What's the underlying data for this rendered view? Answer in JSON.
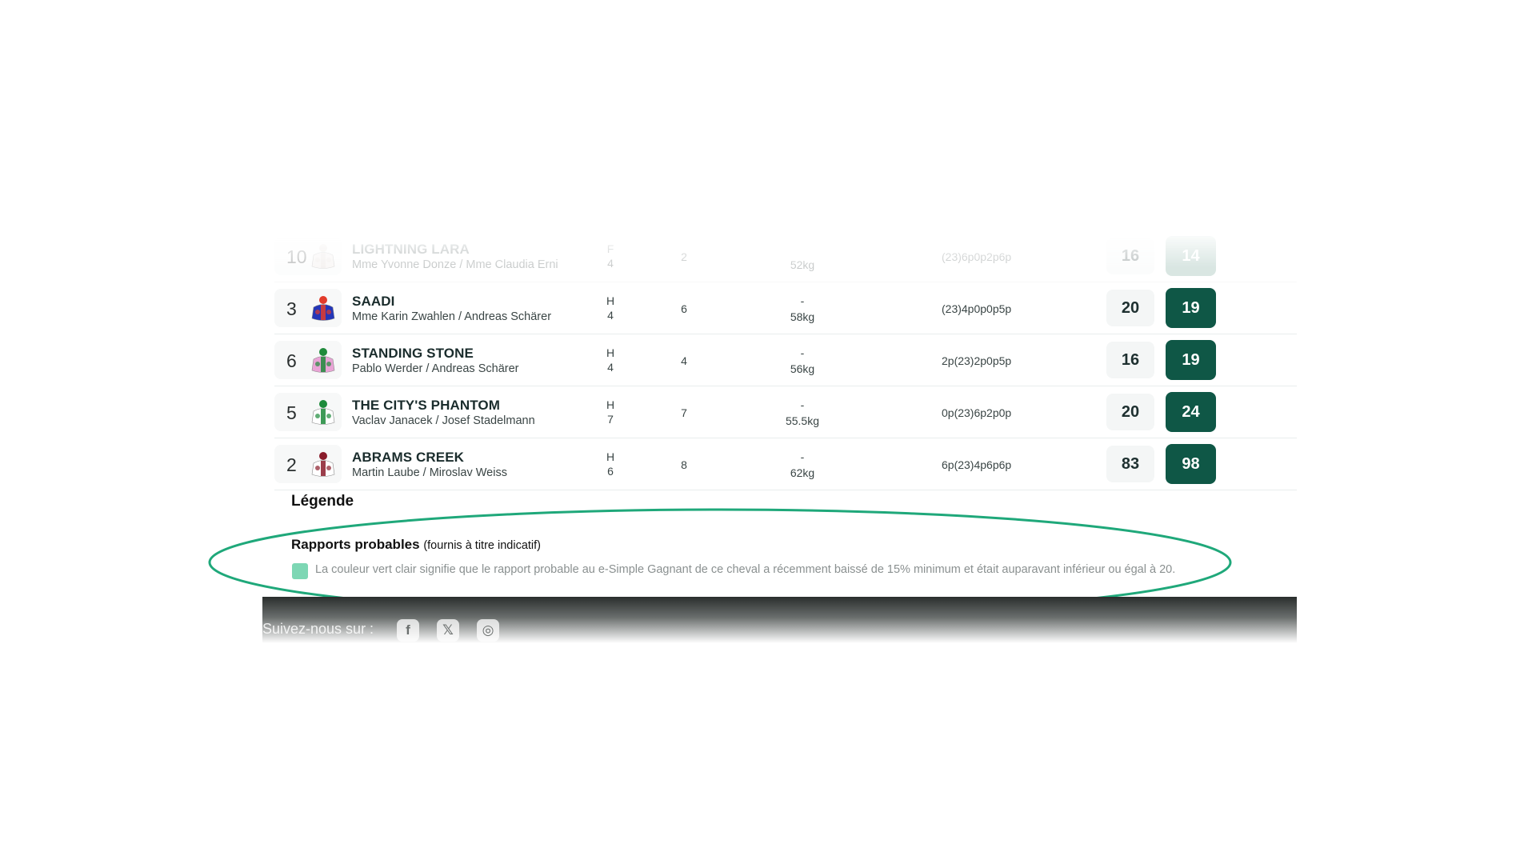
{
  "runners": [
    {
      "num": "10",
      "name": "LIGHTNING LARA",
      "people": "Mme Yvonne Donze / Mme Claudia Erni",
      "sex": "F",
      "age": "4",
      "rope": "2",
      "dash": "",
      "weight": "52kg",
      "music": "(23)6p0p2p6p",
      "odds_prev": "16",
      "odds_now": "14",
      "faded": true,
      "silk": {
        "body": "#ece6e3",
        "accent": "#d9cfca"
      }
    },
    {
      "num": "3",
      "name": "SAADI",
      "people": "Mme Karin Zwahlen / Andreas Schärer",
      "sex": "H",
      "age": "4",
      "rope": "6",
      "dash": "-",
      "weight": "58kg",
      "music": "(23)4p0p0p5p",
      "odds_prev": "20",
      "odds_now": "19",
      "faded": false,
      "silk": {
        "body": "#2436b8",
        "accent": "#e23b2b"
      }
    },
    {
      "num": "6",
      "name": "STANDING STONE",
      "people": "Pablo Werder / Andreas Schärer",
      "sex": "H",
      "age": "4",
      "rope": "4",
      "dash": "-",
      "weight": "56kg",
      "music": "2p(23)2p0p5p",
      "odds_prev": "16",
      "odds_now": "19",
      "faded": false,
      "silk": {
        "body": "#e9a4d6",
        "accent": "#1f8a3b"
      }
    },
    {
      "num": "5",
      "name": "THE CITY'S PHANTOM",
      "people": "Vaclav Janacek / Josef Stadelmann",
      "sex": "H",
      "age": "7",
      "rope": "7",
      "dash": "-",
      "weight": "55.5kg",
      "music": "0p(23)6p2p0p",
      "odds_prev": "20",
      "odds_now": "24",
      "faded": false,
      "silk": {
        "body": "#ffffff",
        "accent": "#1c8a3a"
      }
    },
    {
      "num": "2",
      "name": "ABRAMS CREEK",
      "people": "Martin Laube / Miroslav Weiss",
      "sex": "H",
      "age": "6",
      "rope": "8",
      "dash": "-",
      "weight": "62kg",
      "music": "6p(23)4p6p6p",
      "odds_prev": "83",
      "odds_now": "98",
      "faded": false,
      "silk": {
        "body": "#ffffff",
        "accent": "#8a1c2b"
      }
    }
  ],
  "legend": {
    "title": "Légende",
    "subtitle_strong": "Rapports probables",
    "subtitle_note": "(fournis à titre indicatif)",
    "text": "La couleur vert clair signifie que le rapport probable au e-Simple Gagnant de ce cheval a récemment baissé de 15% minimum et était auparavant inférieur ou égal à 20.",
    "swatch_color": "#7dd7b4"
  },
  "footer": {
    "follow_label": "Suivez-nous sur :",
    "social": [
      "facebook-icon",
      "x-icon",
      "instagram-icon"
    ]
  },
  "colors": {
    "odds_now_bg": "#0f5746",
    "highlight_ring": "#1fa87a"
  }
}
